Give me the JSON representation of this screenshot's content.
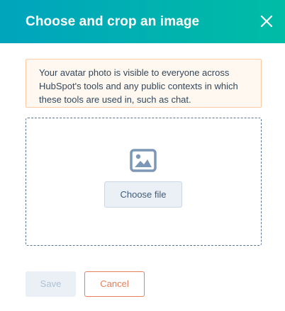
{
  "header": {
    "title": "Choose and crop an image",
    "close_icon": "close-icon",
    "background_gradient": [
      "#00a4bd",
      "#00bda5"
    ]
  },
  "notice": {
    "text": "Your avatar photo is visible to everyone across HubSpot's tools and any public contexts in which these tools are used in, such as chat."
  },
  "dropzone": {
    "icon": "image-icon",
    "choose_label": "Choose file"
  },
  "footer": {
    "save_label": "Save",
    "save_disabled": true,
    "cancel_label": "Cancel"
  },
  "colors": {
    "cancel_accent": "#e5805d",
    "notice_border": "#fbc9a2",
    "notice_background": "#fef8f0",
    "dropzone_border": "#5c7690"
  }
}
